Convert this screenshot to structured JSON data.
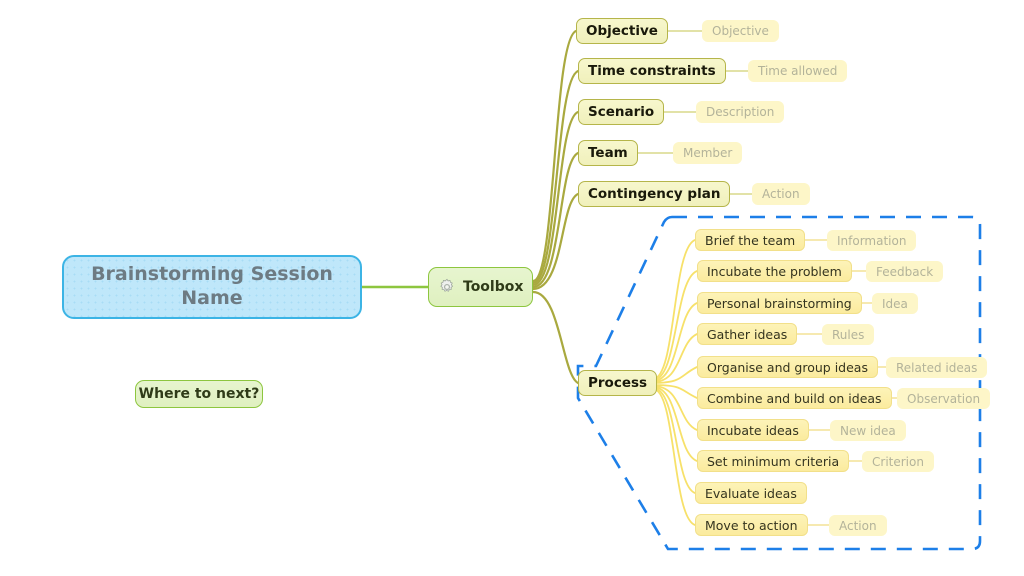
{
  "map": {
    "root": {
      "label_line1": "Brainstorming Session",
      "label_line2": "Name",
      "note_label": "Where to next?"
    },
    "hub": {
      "label": "Toolbox",
      "icon": "gear-icon"
    },
    "branches": [
      {
        "label": "Objective",
        "leaf": "Objective"
      },
      {
        "label": "Time constraints",
        "leaf": "Time allowed"
      },
      {
        "label": "Scenario",
        "leaf": "Description"
      },
      {
        "label": "Team",
        "leaf": "Member"
      },
      {
        "label": "Contingency plan",
        "leaf": "Action"
      },
      {
        "label": "Process",
        "leaf": ""
      }
    ],
    "process": {
      "label": "Process",
      "steps": [
        {
          "label": "Brief the team",
          "leaf": "Information"
        },
        {
          "label": "Incubate the problem",
          "leaf": "Feedback"
        },
        {
          "label": "Personal brainstorming",
          "leaf": "Idea"
        },
        {
          "label": "Gather ideas",
          "leaf": "Rules"
        },
        {
          "label": "Organise and group ideas",
          "leaf": "Related ideas"
        },
        {
          "label": "Combine and build on ideas",
          "leaf": "Observation"
        },
        {
          "label": "Incubate ideas",
          "leaf": "New idea"
        },
        {
          "label": "Set minimum criteria",
          "leaf": "Criterion"
        },
        {
          "label": "Evaluate ideas",
          "leaf": ""
        },
        {
          "label": "Move to action",
          "leaf": "Action"
        }
      ]
    },
    "colors": {
      "root_fill": "#bfe7fa",
      "root_border": "#3cb4e5",
      "root_text": "#6d7b83",
      "green_fill": "#e2f1c6",
      "green_border": "#8dc63f",
      "branch_fill": "#f4f4c4",
      "branch_border": "#b5b54a",
      "sub_fill": "#fceda4",
      "leaf_fill": "#fdf6c8",
      "leaf_text": "#b3b39a",
      "boundary": "#1d7fe8",
      "wire_olive": "#a9a93f",
      "wire_yellow": "#f7e16a",
      "wire_green": "#8dc63f"
    }
  }
}
